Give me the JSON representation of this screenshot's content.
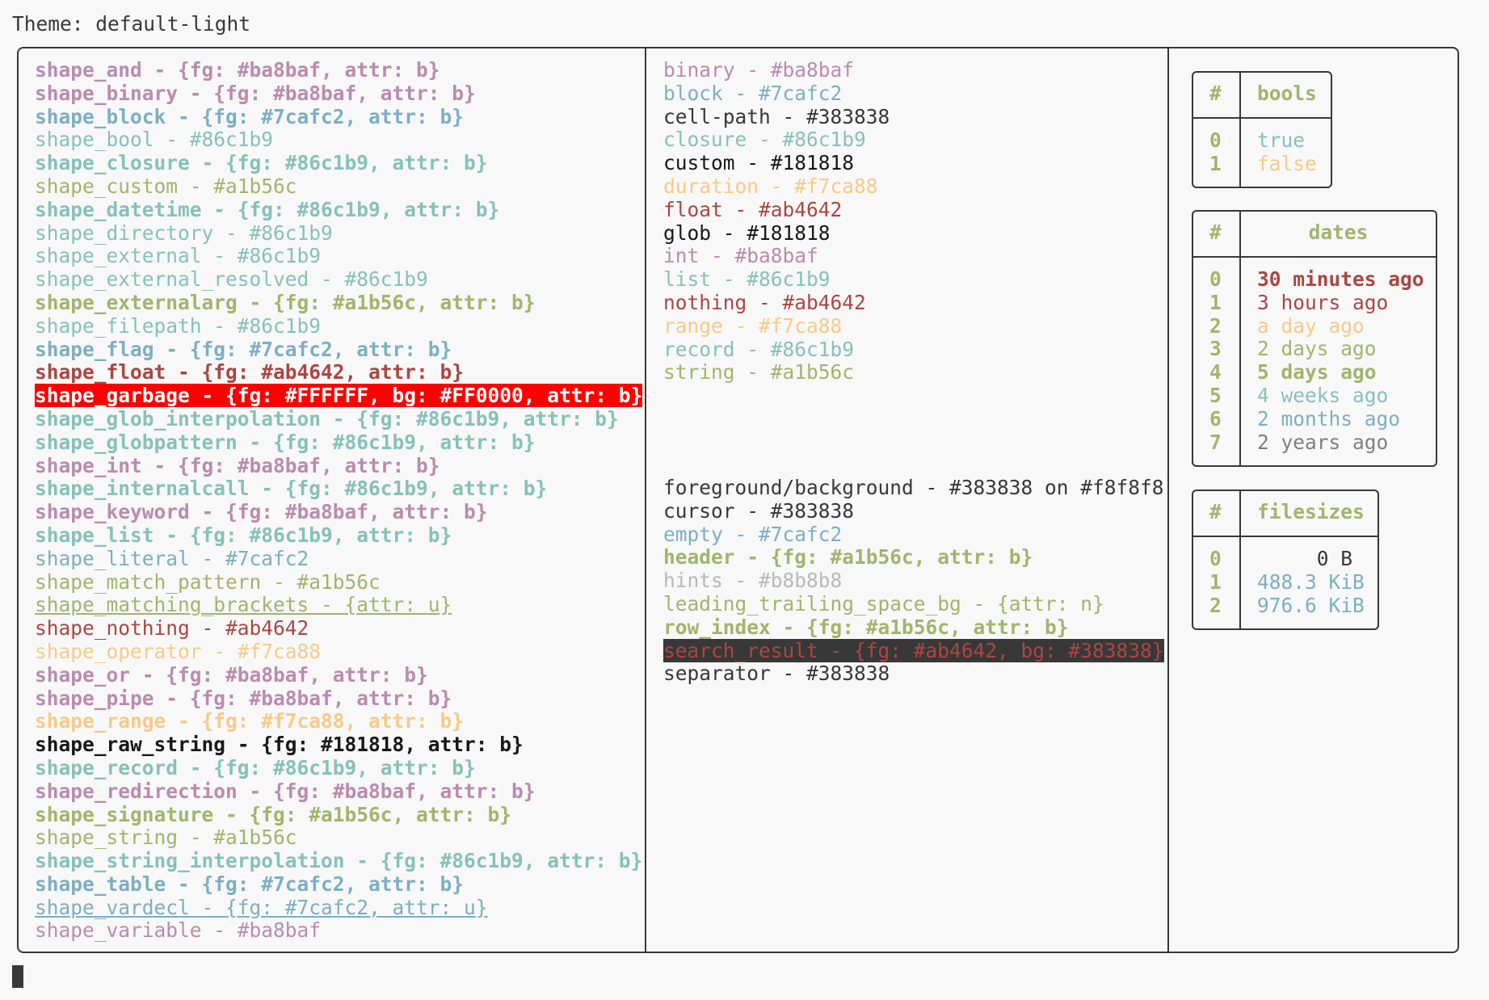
{
  "theme_line": "Theme: default-light",
  "shapes": [
    {
      "text": "shape_and - {fg: #ba8baf, attr: b}",
      "color": "#ba8baf",
      "bold": true
    },
    {
      "text": "shape_binary - {fg: #ba8baf, attr: b}",
      "color": "#ba8baf",
      "bold": true
    },
    {
      "text": "shape_block - {fg: #7cafc2, attr: b}",
      "color": "#7cafc2",
      "bold": true
    },
    {
      "text": "shape_bool - #86c1b9",
      "color": "#86c1b9"
    },
    {
      "text": "shape_closure - {fg: #86c1b9, attr: b}",
      "color": "#86c1b9",
      "bold": true
    },
    {
      "text": "shape_custom - #a1b56c",
      "color": "#a1b56c"
    },
    {
      "text": "shape_datetime - {fg: #86c1b9, attr: b}",
      "color": "#86c1b9",
      "bold": true
    },
    {
      "text": "shape_directory - #86c1b9",
      "color": "#86c1b9"
    },
    {
      "text": "shape_external - #86c1b9",
      "color": "#86c1b9"
    },
    {
      "text": "shape_external_resolved - #86c1b9",
      "color": "#86c1b9"
    },
    {
      "text": "shape_externalarg - {fg: #a1b56c, attr: b}",
      "color": "#a1b56c",
      "bold": true
    },
    {
      "text": "shape_filepath - #86c1b9",
      "color": "#86c1b9"
    },
    {
      "text": "shape_flag - {fg: #7cafc2, attr: b}",
      "color": "#7cafc2",
      "bold": true
    },
    {
      "text": "shape_float - {fg: #ab4642, attr: b}",
      "color": "#ab4642",
      "bold": true
    },
    {
      "text": "shape_garbage - {fg: #FFFFFF, bg: #FF0000, attr: b}",
      "color": "#FFFFFF",
      "bg": "#FF0000",
      "bold": true
    },
    {
      "text": "shape_glob_interpolation - {fg: #86c1b9, attr: b}",
      "color": "#86c1b9",
      "bold": true
    },
    {
      "text": "shape_globpattern - {fg: #86c1b9, attr: b}",
      "color": "#86c1b9",
      "bold": true
    },
    {
      "text": "shape_int - {fg: #ba8baf, attr: b}",
      "color": "#ba8baf",
      "bold": true
    },
    {
      "text": "shape_internalcall - {fg: #86c1b9, attr: b}",
      "color": "#86c1b9",
      "bold": true
    },
    {
      "text": "shape_keyword - {fg: #ba8baf, attr: b}",
      "color": "#ba8baf",
      "bold": true
    },
    {
      "text": "shape_list - {fg: #86c1b9, attr: b}",
      "color": "#86c1b9",
      "bold": true
    },
    {
      "text": "shape_literal - #7cafc2",
      "color": "#7cafc2"
    },
    {
      "text": "shape_match_pattern - #a1b56c",
      "color": "#a1b56c"
    },
    {
      "text": "shape_matching_brackets - {attr: u}",
      "color": "#a1b56c",
      "underline": true
    },
    {
      "text": "shape_nothing - #ab4642",
      "color": "#ab4642"
    },
    {
      "text": "shape_operator - #f7ca88",
      "color": "#f7ca88"
    },
    {
      "text": "shape_or - {fg: #ba8baf, attr: b}",
      "color": "#ba8baf",
      "bold": true
    },
    {
      "text": "shape_pipe - {fg: #ba8baf, attr: b}",
      "color": "#ba8baf",
      "bold": true
    },
    {
      "text": "shape_range - {fg: #f7ca88, attr: b}",
      "color": "#f7ca88",
      "bold": true
    },
    {
      "text": "shape_raw_string - {fg: #181818, attr: b}",
      "color": "#181818",
      "bold": true
    },
    {
      "text": "shape_record - {fg: #86c1b9, attr: b}",
      "color": "#86c1b9",
      "bold": true
    },
    {
      "text": "shape_redirection - {fg: #ba8baf, attr: b}",
      "color": "#ba8baf",
      "bold": true
    },
    {
      "text": "shape_signature - {fg: #a1b56c, attr: b}",
      "color": "#a1b56c",
      "bold": true
    },
    {
      "text": "shape_string - #a1b56c",
      "color": "#a1b56c"
    },
    {
      "text": "shape_string_interpolation - {fg: #86c1b9, attr: b}",
      "color": "#86c1b9",
      "bold": true
    },
    {
      "text": "shape_table - {fg: #7cafc2, attr: b}",
      "color": "#7cafc2",
      "bold": true
    },
    {
      "text": "shape_vardecl - {fg: #7cafc2, attr: u}",
      "color": "#7cafc2",
      "underline": true
    },
    {
      "text": "shape_variable - #ba8baf",
      "color": "#ba8baf"
    }
  ],
  "types": [
    {
      "text": "binary - #ba8baf",
      "color": "#ba8baf"
    },
    {
      "text": "block - #7cafc2",
      "color": "#7cafc2"
    },
    {
      "text": "cell-path - #383838",
      "color": "#383838"
    },
    {
      "text": "closure - #86c1b9",
      "color": "#86c1b9"
    },
    {
      "text": "custom - #181818",
      "color": "#181818"
    },
    {
      "text": "duration - #f7ca88",
      "color": "#f7ca88"
    },
    {
      "text": "float - #ab4642",
      "color": "#ab4642"
    },
    {
      "text": "glob - #181818",
      "color": "#181818"
    },
    {
      "text": "int - #ba8baf",
      "color": "#ba8baf"
    },
    {
      "text": "list - #86c1b9",
      "color": "#86c1b9"
    },
    {
      "text": "nothing - #ab4642",
      "color": "#ab4642"
    },
    {
      "text": "range - #f7ca88",
      "color": "#f7ca88"
    },
    {
      "text": "record - #86c1b9",
      "color": "#86c1b9"
    },
    {
      "text": "string - #a1b56c",
      "color": "#a1b56c"
    }
  ],
  "ui": [
    {
      "text": "foreground/background - #383838 on #f8f8f8",
      "color": "#383838"
    },
    {
      "text": "cursor - #383838",
      "color": "#383838"
    },
    {
      "text": "empty - #7cafc2",
      "color": "#7cafc2"
    },
    {
      "text": "header - {fg: #a1b56c, attr: b}",
      "color": "#a1b56c",
      "bold": true
    },
    {
      "text": "hints - #b8b8b8",
      "color": "#b8b8b8"
    },
    {
      "text": "leading_trailing_space_bg - {attr: n}",
      "color": "#a1b56c"
    },
    {
      "text": "row_index - {fg: #a1b56c, attr: b}",
      "color": "#a1b56c",
      "bold": true
    },
    {
      "text": "search_result - {fg: #ab4642, bg: #383838}",
      "color": "#ab4642",
      "bg": "#383838"
    },
    {
      "text": "separator - #383838",
      "color": "#383838"
    }
  ],
  "bools": {
    "index_header": "#",
    "header": "bools",
    "rows": [
      {
        "index": "0",
        "value": "true",
        "color": "#86c1b9"
      },
      {
        "index": "1",
        "value": "false",
        "color": "#f7ca88"
      }
    ]
  },
  "dates": {
    "index_header": "#",
    "header": "dates",
    "rows": [
      {
        "index": "0",
        "value": "30 minutes ago",
        "color": "#ab4642",
        "bold": true
      },
      {
        "index": "1",
        "value": "3 hours ago",
        "color": "#ab4642"
      },
      {
        "index": "2",
        "value": "a day ago",
        "color": "#f7ca88"
      },
      {
        "index": "3",
        "value": "2 days ago",
        "color": "#a1b56c"
      },
      {
        "index": "4",
        "value": "5 days ago",
        "color": "#a1b56c",
        "bold": true
      },
      {
        "index": "5",
        "value": "4 weeks ago",
        "color": "#86c1b9"
      },
      {
        "index": "6",
        "value": "2 months ago",
        "color": "#7cafc2"
      },
      {
        "index": "7",
        "value": "2 years ago",
        "color": "#808080"
      }
    ]
  },
  "filesizes": {
    "index_header": "#",
    "header": "filesizes",
    "rows": [
      {
        "index": "0",
        "value": "     0 B",
        "color": "#383838"
      },
      {
        "index": "1",
        "value": "488.3 KiB",
        "color": "#7cafc2"
      },
      {
        "index": "2",
        "value": "976.6 KiB",
        "color": "#7cafc2"
      }
    ]
  }
}
